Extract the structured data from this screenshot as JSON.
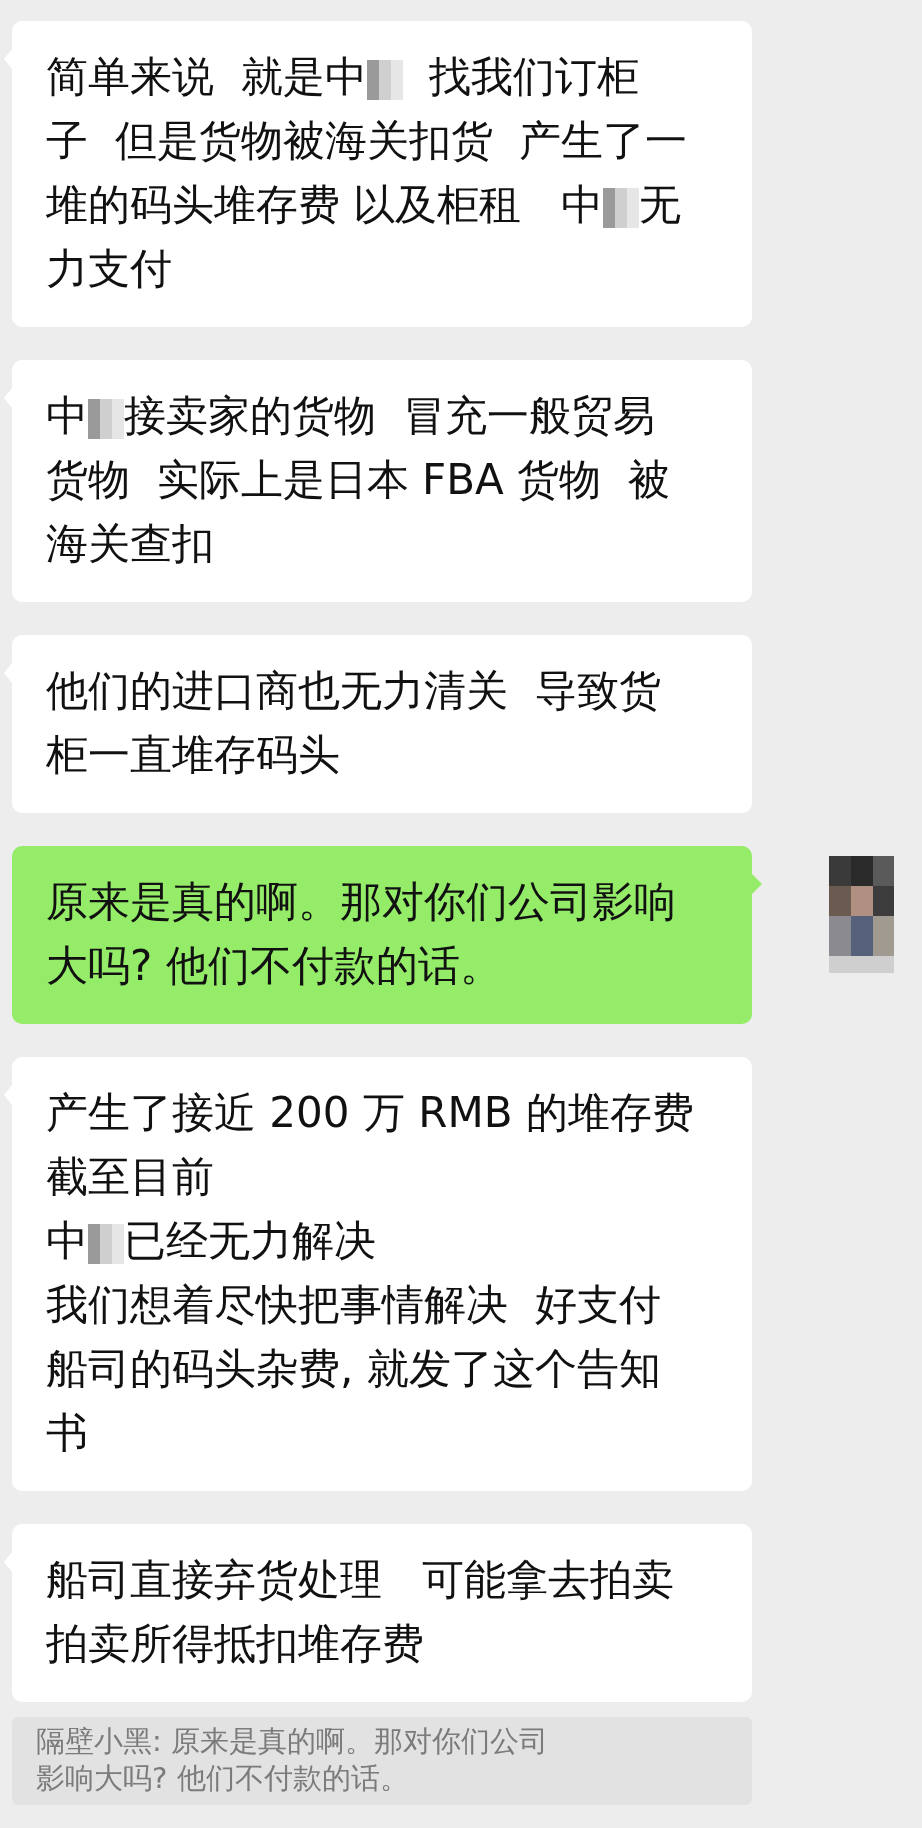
{
  "messages": [
    {
      "kind": "received",
      "lines": [
        [
          {
            "kind": "text",
            "text": "简单来说  就是中"
          },
          {
            "kind": "mosaic"
          },
          {
            "kind": "text",
            "text": "  找我们订柜"
          }
        ],
        [
          {
            "kind": "text",
            "text": "子  但是货物被海关扣货  产生了一"
          }
        ],
        [
          {
            "kind": "text",
            "text": "堆的码头堆存费 以及柜租   中"
          },
          {
            "kind": "mosaic"
          },
          {
            "kind": "text",
            "text": "无"
          }
        ],
        [
          {
            "kind": "text",
            "text": "力支付"
          }
        ]
      ]
    },
    {
      "kind": "received",
      "lines": [
        [
          {
            "kind": "text",
            "text": "中"
          },
          {
            "kind": "mosaic"
          },
          {
            "kind": "text",
            "text": "接卖家的货物  冒充一般贸易"
          }
        ],
        [
          {
            "kind": "text",
            "text": "货物  实际上是日本 FBA 货物  被"
          }
        ],
        [
          {
            "kind": "text",
            "text": "海关查扣"
          }
        ]
      ]
    },
    {
      "kind": "received",
      "lines": [
        [
          {
            "kind": "text",
            "text": "他们的进口商也无力清关  导致货"
          }
        ],
        [
          {
            "kind": "text",
            "text": "柜一直堆存码头"
          }
        ]
      ]
    },
    {
      "kind": "sent",
      "lines": [
        [
          {
            "kind": "text",
            "text": "原来是真的啊。那对你们公司影响"
          }
        ],
        [
          {
            "kind": "text",
            "text": "大吗? 他们不付款的话。"
          }
        ]
      ]
    },
    {
      "kind": "received",
      "lines": [
        [
          {
            "kind": "text",
            "text": "产生了接近 200 万 RMB 的堆存费"
          }
        ],
        [
          {
            "kind": "text",
            "text": "截至目前"
          }
        ],
        [
          {
            "kind": "text",
            "text": "中"
          },
          {
            "kind": "mosaic"
          },
          {
            "kind": "text",
            "text": "已经无力解决"
          }
        ],
        [
          {
            "kind": "text",
            "text": "我们想着尽快把事情解决  好支付"
          }
        ],
        [
          {
            "kind": "text",
            "text": "船司的码头杂费, 就发了这个告知"
          }
        ],
        [
          {
            "kind": "text",
            "text": "书"
          }
        ]
      ]
    },
    {
      "kind": "received",
      "lines": [
        [
          {
            "kind": "text",
            "text": "船司直接弃货处理   可能拿去拍卖"
          }
        ],
        [
          {
            "kind": "text",
            "text": "拍卖所得抵扣堆存费"
          }
        ]
      ]
    }
  ],
  "quote": {
    "lines": [
      "隔壁小黑: 原来是真的啊。那对你们公司",
      "影响大吗? 他们不付款的话。"
    ]
  }
}
